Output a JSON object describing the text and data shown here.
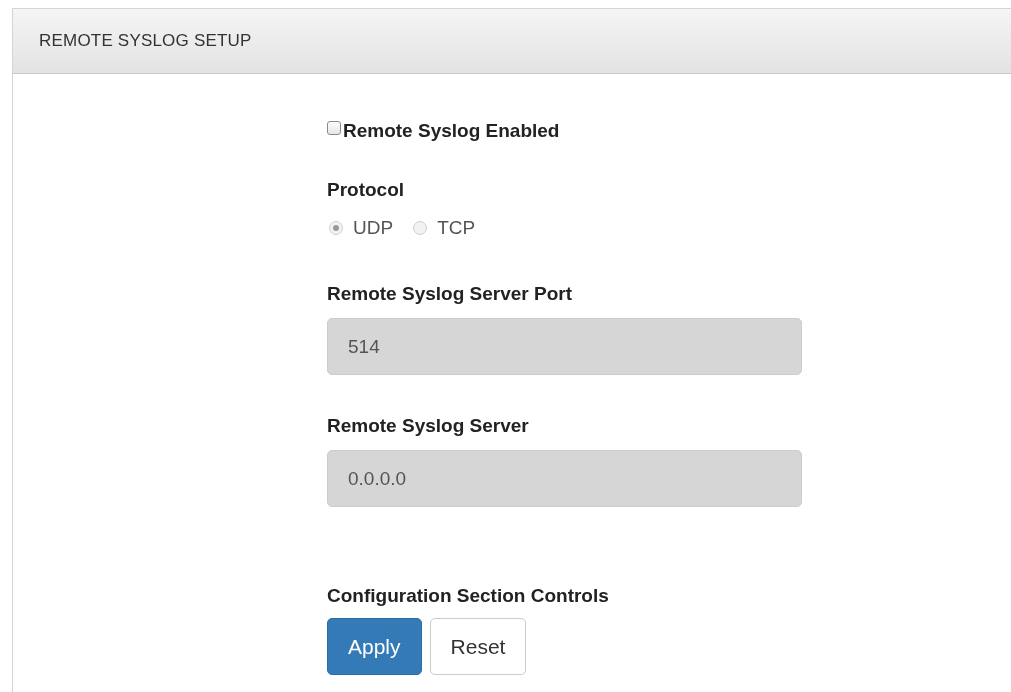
{
  "panel": {
    "title": "REMOTE SYSLOG SETUP"
  },
  "enabled": {
    "label": "Remote Syslog Enabled",
    "checked": false
  },
  "protocol": {
    "label": "Protocol",
    "disabled": true,
    "options": [
      {
        "label": "UDP",
        "selected": true
      },
      {
        "label": "TCP",
        "selected": false
      }
    ]
  },
  "fields": [
    {
      "label": "Remote Syslog Server Port",
      "value": "514",
      "disabled": true
    },
    {
      "label": "Remote Syslog Server",
      "value": "0.0.0.0",
      "disabled": true
    }
  ],
  "controls": {
    "label": "Configuration Section Controls",
    "buttons": [
      {
        "label": "Apply",
        "kind": "primary"
      },
      {
        "label": "Reset",
        "kind": "default"
      }
    ]
  }
}
